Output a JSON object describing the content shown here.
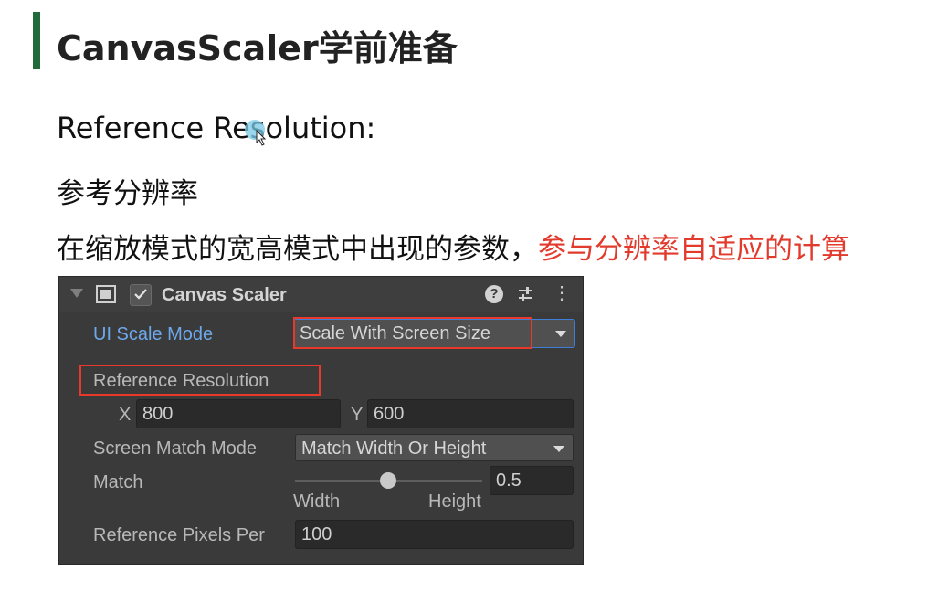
{
  "slide": {
    "title": "CanvasScaler学前准备",
    "line1": "Reference Resolution:",
    "line2": "参考分辨率",
    "line3_plain": "在缩放模式的宽高模式中出现的参数，",
    "line3_highlight": "参与分辨率自适应的计算",
    "highlight_color": "#e23a2c",
    "accent_color": "#1f6b3a"
  },
  "inspector": {
    "component_name": "Canvas Scaler",
    "enabled": true,
    "ui_scale_mode_label": "UI Scale Mode",
    "ui_scale_mode_value": "Scale With Screen Size",
    "reference_resolution_label": "Reference Resolution",
    "x_label": "X",
    "x_value": "800",
    "y_label": "Y",
    "y_value": "600",
    "screen_match_mode_label": "Screen Match Mode",
    "screen_match_mode_value": "Match Width Or Height",
    "match_label": "Match",
    "match_value": "0.5",
    "match_min_label": "Width",
    "match_max_label": "Height",
    "ref_pixels_label": "Reference Pixels Per",
    "ref_pixels_value": "100",
    "icons": [
      "fold-arrow-icon",
      "canvas-scaler-component-icon",
      "checkbox-icon",
      "help-icon",
      "preset-settings-icon",
      "more-options-icon"
    ]
  }
}
